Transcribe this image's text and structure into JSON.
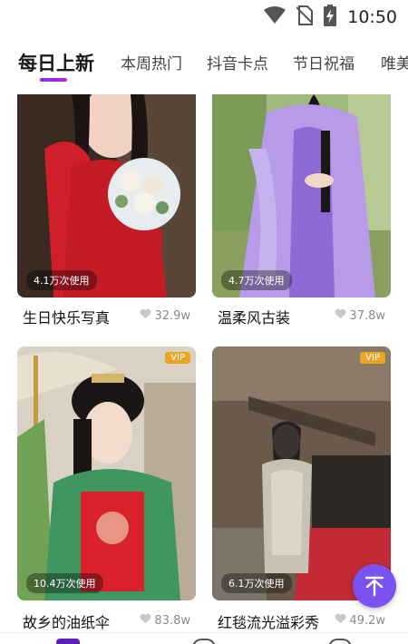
{
  "status_bar": {
    "time": "10:50",
    "icons": [
      "wifi-icon",
      "no-sim-icon",
      "battery-charging-icon"
    ]
  },
  "tabs": [
    {
      "label": "每日上新",
      "active": true
    },
    {
      "label": "本周热门",
      "active": false
    },
    {
      "label": "抖音卡点",
      "active": false
    },
    {
      "label": "节日祝福",
      "active": false
    },
    {
      "label": "唯美",
      "active": false
    }
  ],
  "cards": [
    {
      "title": "生日快乐写真",
      "usage": "4.1万次使用",
      "likes": "32.9w",
      "vip": false
    },
    {
      "title": "温柔风古装",
      "usage": "4.7万次使用",
      "likes": "37.8w",
      "vip": false
    },
    {
      "title": "故乡的油纸伞",
      "usage": "10.4万次使用",
      "likes": "83.8w",
      "vip": true,
      "vip_label": "VIP"
    },
    {
      "title": "红毯流光溢彩秀",
      "usage": "6.1万次使用",
      "likes": "49.2w",
      "vip": true,
      "vip_label": "VIP"
    }
  ],
  "fab_icon": "arrow-up-to-top-icon",
  "accent_color": "#7b53f0"
}
